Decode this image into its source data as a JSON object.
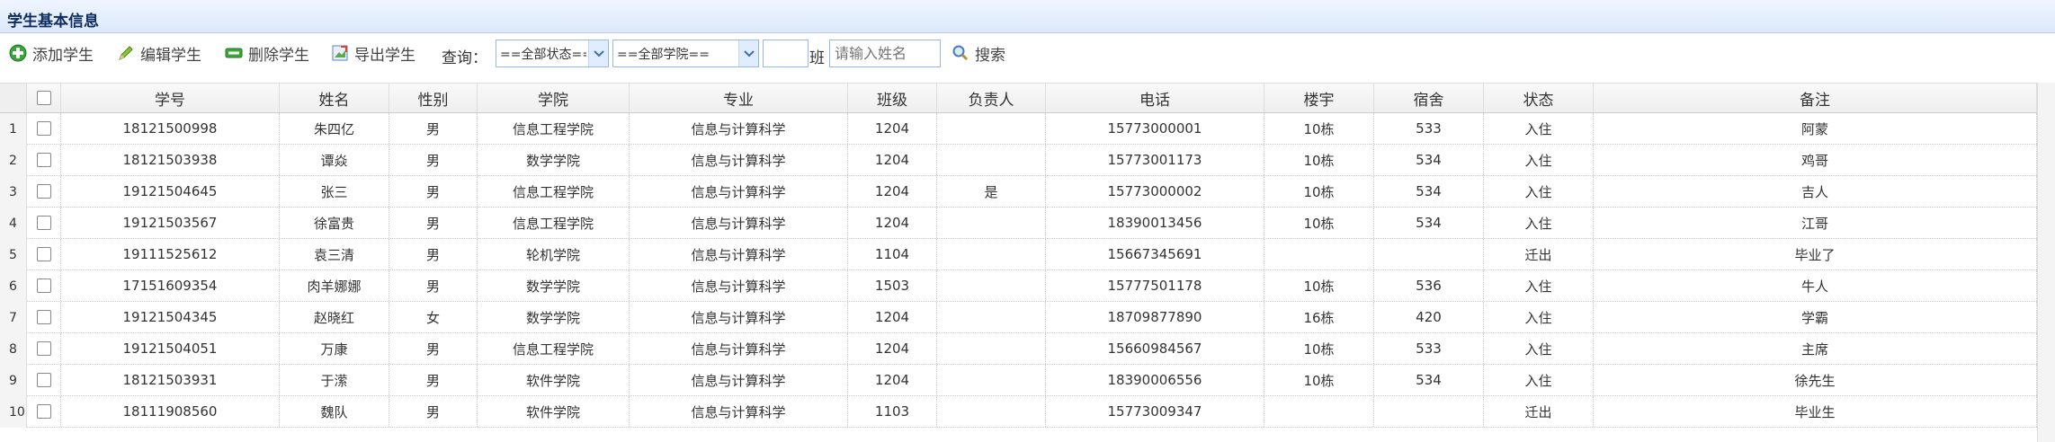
{
  "panel": {
    "title": "学生基本信息"
  },
  "toolbar": {
    "add_label": "添加学生",
    "edit_label": "编辑学生",
    "delete_label": "删除学生",
    "export_label": "导出学生",
    "query_label": "查询：",
    "status_select": "==全部状态==",
    "college_select": "==全部学院==",
    "class_value": "",
    "class_suffix": "班",
    "name_placeholder": "请输入姓名",
    "search_label": "搜索"
  },
  "table": {
    "headers": [
      "学号",
      "姓名",
      "性别",
      "学院",
      "专业",
      "班级",
      "负责人",
      "电话",
      "楼宇",
      "宿舍",
      "状态",
      "备注"
    ],
    "rows": [
      {
        "num": "1",
        "cells": [
          "18121500998",
          "朱四亿",
          "男",
          "信息工程学院",
          "信息与计算科学",
          "1204",
          "",
          "15773000001",
          "10栋",
          "533",
          "入住",
          "阿蒙"
        ]
      },
      {
        "num": "2",
        "cells": [
          "18121503938",
          "谭焱",
          "男",
          "数学学院",
          "信息与计算科学",
          "1204",
          "",
          "15773001173",
          "10栋",
          "534",
          "入住",
          "鸡哥"
        ]
      },
      {
        "num": "3",
        "cells": [
          "19121504645",
          "张三",
          "男",
          "信息工程学院",
          "信息与计算科学",
          "1204",
          "是",
          "15773000002",
          "10栋",
          "534",
          "入住",
          "吉人"
        ]
      },
      {
        "num": "4",
        "cells": [
          "19121503567",
          "徐富贵",
          "男",
          "信息工程学院",
          "信息与计算科学",
          "1204",
          "",
          "18390013456",
          "10栋",
          "534",
          "入住",
          "江哥"
        ]
      },
      {
        "num": "5",
        "cells": [
          "19111525612",
          "袁三清",
          "男",
          "轮机学院",
          "信息与计算科学",
          "1104",
          "",
          "15667345691",
          "",
          "",
          "迁出",
          "毕业了"
        ]
      },
      {
        "num": "6",
        "cells": [
          "17151609354",
          "肉羊娜娜",
          "男",
          "数学学院",
          "信息与计算科学",
          "1503",
          "",
          "15777501178",
          "10栋",
          "536",
          "入住",
          "牛人"
        ]
      },
      {
        "num": "7",
        "cells": [
          "19121504345",
          "赵晓红",
          "女",
          "数学学院",
          "信息与计算科学",
          "1204",
          "",
          "18709877890",
          "16栋",
          "420",
          "入住",
          "学霸"
        ]
      },
      {
        "num": "8",
        "cells": [
          "19121504051",
          "万康",
          "男",
          "信息工程学院",
          "信息与计算科学",
          "1204",
          "",
          "15660984567",
          "10栋",
          "533",
          "入住",
          "主席"
        ]
      },
      {
        "num": "9",
        "cells": [
          "18121503931",
          "于潆",
          "男",
          "软件学院",
          "信息与计算科学",
          "1204",
          "",
          "18390006556",
          "10栋",
          "534",
          "入住",
          "徐先生"
        ]
      },
      {
        "num": "10",
        "cells": [
          "18111908560",
          "魏队",
          "男",
          "软件学院",
          "信息与计算科学",
          "1103",
          "",
          "15773009347",
          "",
          "",
          "迁出",
          "毕业生"
        ]
      }
    ]
  }
}
